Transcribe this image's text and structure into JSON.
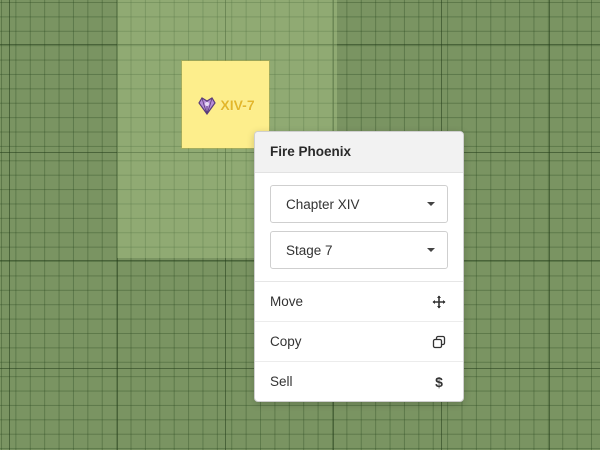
{
  "tile": {
    "label": "XIV-7",
    "icon": "crystal-emblem-icon",
    "color": "#fdee8c",
    "label_color": "#e3b72a"
  },
  "context_menu": {
    "title": "Fire Phoenix",
    "chapter_select": {
      "value": "Chapter XIV"
    },
    "stage_select": {
      "value": "Stage 7"
    },
    "actions": [
      {
        "label": "Move",
        "icon": "move-arrows-icon"
      },
      {
        "label": "Copy",
        "icon": "copy-icon"
      },
      {
        "label": "Sell",
        "icon": "dollar-icon",
        "symbol": "$"
      }
    ]
  },
  "colors": {
    "board": "#7a9462",
    "highlight": "#9fb585"
  }
}
